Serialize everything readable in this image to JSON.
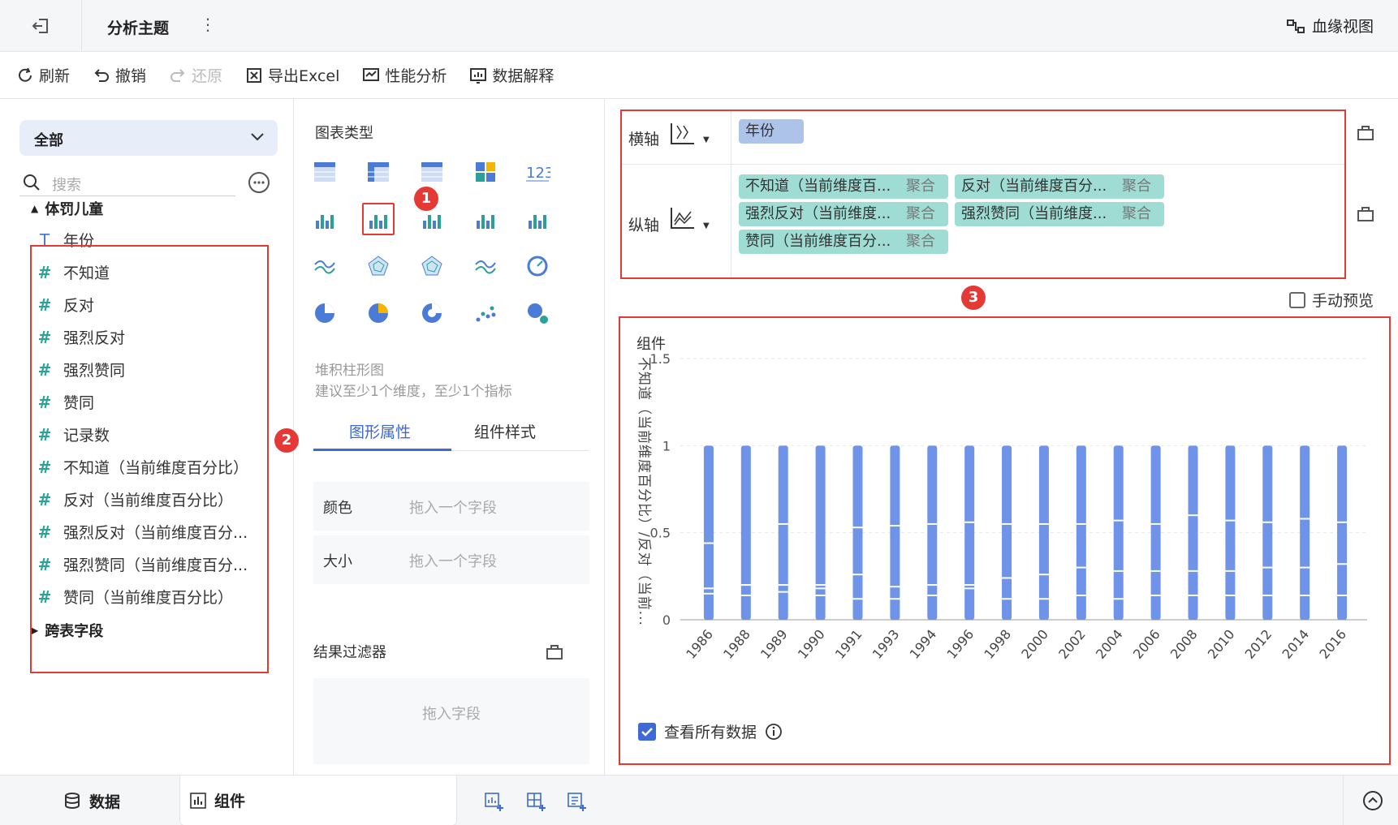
{
  "header": {
    "title": "分析主题",
    "lineage_label": "血缘视图"
  },
  "toolbar": {
    "refresh": "刷新",
    "undo": "撤销",
    "redo": "还原",
    "export": "导出Excel",
    "perf": "性能分析",
    "explain": "数据解释"
  },
  "left": {
    "scope": "全部",
    "search_placeholder": "搜索",
    "table_name": "体罚儿童",
    "fields": [
      {
        "type": "text",
        "label": "年份"
      },
      {
        "type": "num",
        "label": "不知道"
      },
      {
        "type": "num",
        "label": "反对"
      },
      {
        "type": "num",
        "label": "强烈反对"
      },
      {
        "type": "num",
        "label": "强烈赞同"
      },
      {
        "type": "num",
        "label": "赞同"
      },
      {
        "type": "calc",
        "label": "记录数"
      },
      {
        "type": "calc",
        "label": "不知道（当前维度百分比）"
      },
      {
        "type": "calc",
        "label": "反对（当前维度百分比）"
      },
      {
        "type": "calc",
        "label": "强烈反对（当前维度百分..."
      },
      {
        "type": "calc",
        "label": "强烈赞同（当前维度百分..."
      },
      {
        "type": "calc",
        "label": "赞同（当前维度百分比）"
      }
    ],
    "cross_table": "跨表字段"
  },
  "middle": {
    "chart_types_label": "图表类型",
    "selected_name": "堆积柱形图",
    "selected_hint": "建议至少1个维度，至少1个指标",
    "tab_graph": "图形属性",
    "tab_style": "组件样式",
    "group_all": "全部",
    "color_label": "颜色",
    "size_label": "大小",
    "drop_hint": "拖入一个字段",
    "result_filter": "结果过滤器",
    "drop_field": "拖入字段"
  },
  "right": {
    "x_axis_label": "横轴",
    "y_axis_label": "纵轴",
    "x_field": "年份",
    "y_fields": [
      {
        "name": "不知道（当前维度百...",
        "agg": "聚合"
      },
      {
        "name": "反对（当前维度百分...",
        "agg": "聚合"
      },
      {
        "name": "强烈反对（当前维度...",
        "agg": "聚合"
      },
      {
        "name": "强烈赞同（当前维度...",
        "agg": "聚合"
      },
      {
        "name": "赞同（当前维度百分...",
        "agg": "聚合"
      }
    ],
    "manual_preview": "手动预览",
    "component_title": "组件",
    "view_all": "查看所有数据"
  },
  "badges": [
    "1",
    "2",
    "3"
  ],
  "bottom": {
    "data_tab": "数据",
    "component_tab": "组件"
  },
  "chart_data": {
    "type": "bar",
    "ylabel": "不知道（当前维度百分比）/反对（当前...",
    "ylim": [
      0,
      1.5
    ],
    "yticks": [
      "0",
      "0.5",
      "1",
      "1.5"
    ],
    "categories": [
      "1986",
      "1988",
      "1989",
      "1990",
      "1991",
      "1993",
      "1994",
      "1996",
      "1998",
      "2000",
      "2002",
      "2004",
      "2006",
      "2008",
      "2010",
      "2012",
      "2014",
      "2016"
    ],
    "series_color": "#6f93e8",
    "stack_breaks": [
      [
        0.15,
        0.18,
        0.44
      ],
      [
        0.14,
        0.2,
        0.2
      ],
      [
        0.16,
        0.2,
        0.55
      ],
      [
        0.14,
        0.18,
        0.2
      ],
      [
        0.12,
        0.26,
        0.53
      ],
      [
        0.12,
        0.19,
        0.54
      ],
      [
        0.14,
        0.2,
        0.55
      ],
      [
        0.18,
        0.2,
        0.56
      ],
      [
        0.12,
        0.24,
        0.55
      ],
      [
        0.12,
        0.26,
        0.55
      ],
      [
        0.14,
        0.3,
        0.55
      ],
      [
        0.12,
        0.28,
        0.57
      ],
      [
        0.14,
        0.28,
        0.55
      ],
      [
        0.14,
        0.28,
        0.6
      ],
      [
        0.14,
        0.28,
        0.57
      ],
      [
        0.14,
        0.3,
        0.56
      ],
      [
        0.14,
        0.3,
        0.58
      ],
      [
        0.14,
        0.32,
        0.56
      ]
    ]
  }
}
